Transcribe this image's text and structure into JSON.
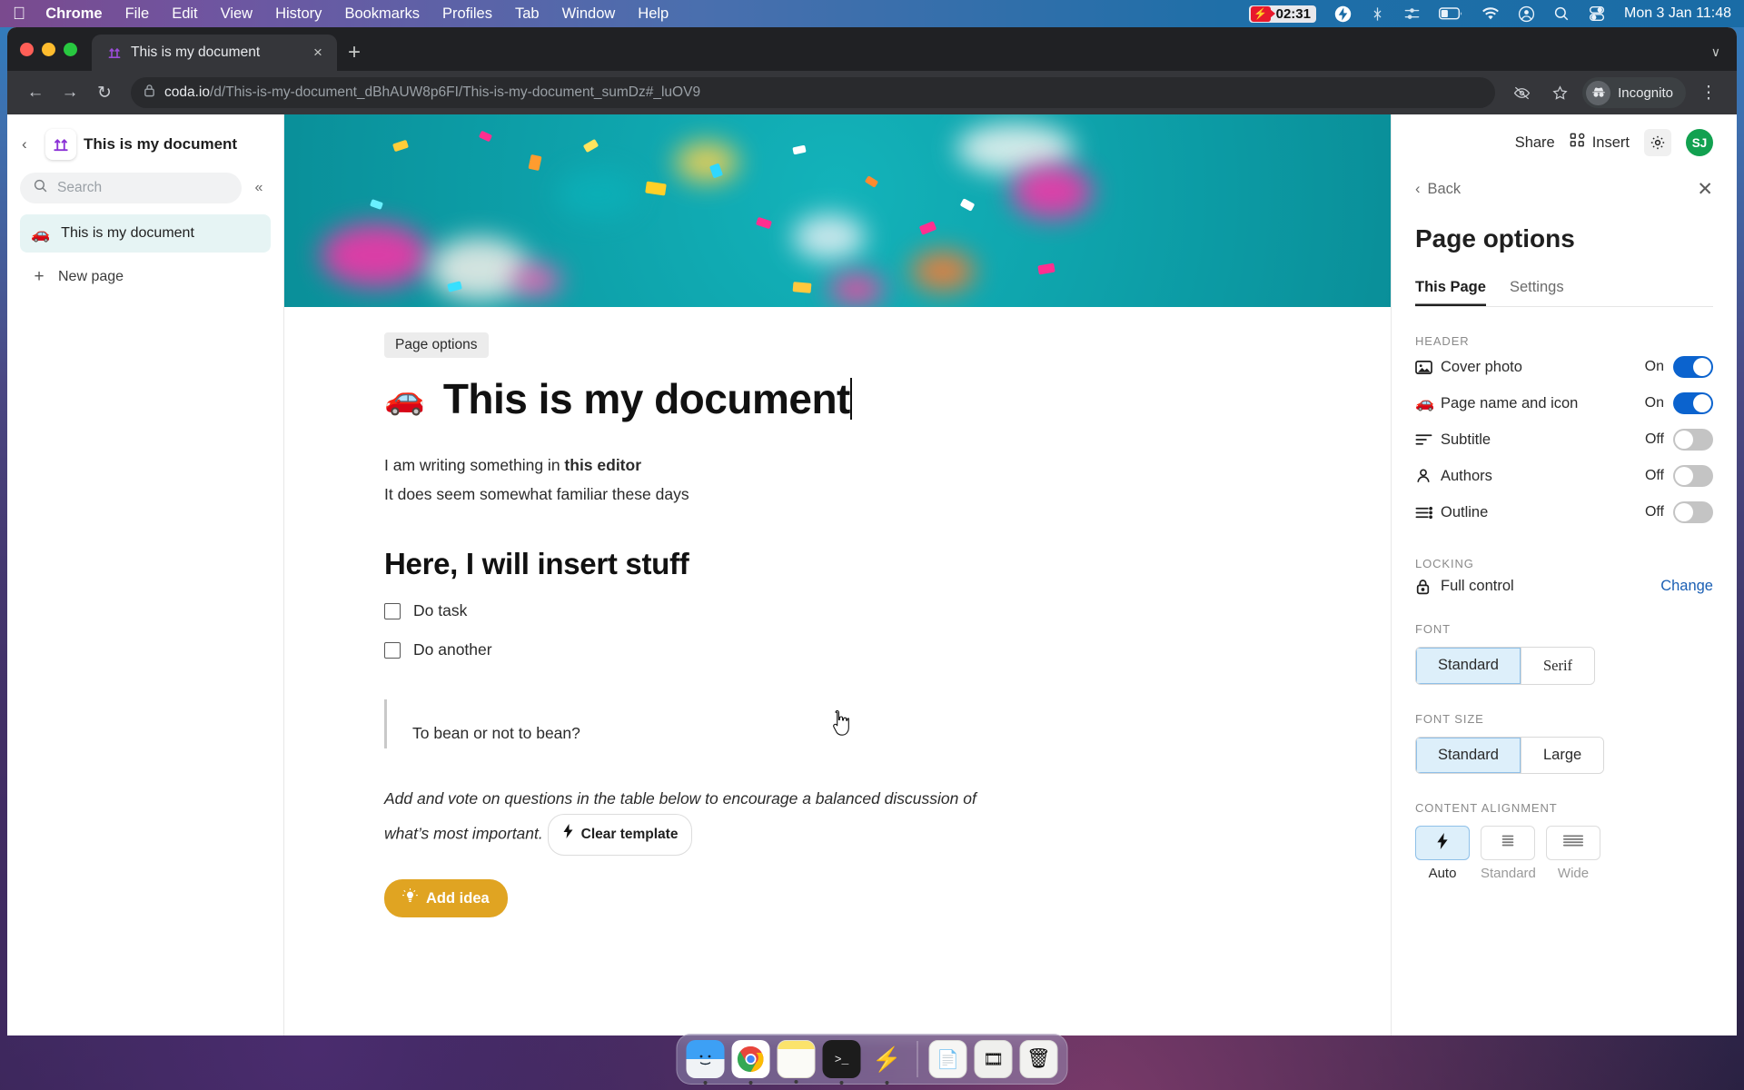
{
  "menubar": {
    "apple": "",
    "items": [
      {
        "label": "Chrome",
        "bold": true
      },
      {
        "label": "File",
        "bold": false
      },
      {
        "label": "Edit",
        "bold": false
      },
      {
        "label": "View",
        "bold": false
      },
      {
        "label": "History",
        "bold": false
      },
      {
        "label": "Bookmarks",
        "bold": false
      },
      {
        "label": "Profiles",
        "bold": false
      },
      {
        "label": "Tab",
        "bold": false
      },
      {
        "label": "Window",
        "bold": false
      },
      {
        "label": "Help",
        "bold": false
      }
    ],
    "recording_time": "02:31",
    "clock": "Mon 3 Jan  11:48",
    "status_icons": [
      "screen-recorder-icon",
      "lightning-icon",
      "bluetooth-off-icon",
      "control-center-icon",
      "battery-icon",
      "wifi-icon",
      "account-icon",
      "search-icon",
      "toggles-icon"
    ]
  },
  "browser": {
    "tab": {
      "title": "This is my document",
      "favicon": "coda-arrows-icon",
      "close": "×"
    },
    "new_tab": "+",
    "tab_list_chevron": "∨",
    "nav": {
      "back": "←",
      "forward": "→",
      "reload": "↻"
    },
    "url_domain": "coda.io",
    "url_path": "/d/This-is-my-document_dBhAUW8p6FI/This-is-my-document_sumDz#_luOV9",
    "lock_icon": "lock-icon",
    "eye_icon": "third-party-cookies-icon",
    "star_icon": "bookmark-star-icon",
    "incognito_label": "Incognito",
    "menu_icon": "⋮"
  },
  "sidebar": {
    "back_chevron": "‹",
    "doc_icon": "coda-arrows-icon",
    "doc_title": "This is my document",
    "search": {
      "placeholder": "Search",
      "value": "",
      "icon": "search-icon"
    },
    "collapse_icon": "«",
    "pages": [
      {
        "label": "This is my document",
        "emoji": "🚗",
        "active": true
      }
    ],
    "new_page": {
      "label": "New page",
      "icon": "plus-icon"
    }
  },
  "document": {
    "tooltip": "Page options",
    "emoji": "🚗",
    "title": "This is my document",
    "paragraphs": [
      {
        "text": "I am writing something in ",
        "bold_tail": "this editor"
      },
      {
        "text": "It does seem somewhat familiar these days",
        "bold_tail": ""
      }
    ],
    "heading2": "Here, I will insert stuff",
    "todos": [
      {
        "label": "Do task",
        "checked": false
      },
      {
        "label": "Do another",
        "checked": false
      }
    ],
    "quote": "To bean or not to bean?",
    "callout": "Add and vote on questions in the table below to encourage a balanced discussion of what’s most important.",
    "clear_template_button": "Clear template",
    "add_idea_button": "Add idea"
  },
  "right_panel": {
    "share_label": "Share",
    "insert_label": "Insert",
    "insert_icon": "grid-squares-icon",
    "gear_icon": "gear-icon",
    "avatar_initials": "SJ",
    "avatar_color": "#12a150",
    "back_label": "Back",
    "back_chevron": "‹",
    "close_icon": "✕",
    "title": "Page options",
    "tabs": [
      {
        "label": "This Page",
        "active": true
      },
      {
        "label": "Settings",
        "active": false
      }
    ],
    "header_section": {
      "label": "HEADER",
      "options": [
        {
          "label": "Cover photo",
          "state": "On",
          "on": true,
          "icon": "image-icon"
        },
        {
          "label": "Page name and icon",
          "state": "On",
          "on": true,
          "icon": "car-emoji-icon"
        },
        {
          "label": "Subtitle",
          "state": "Off",
          "on": false,
          "icon": "subtitle-lines-icon"
        },
        {
          "label": "Authors",
          "state": "Off",
          "on": false,
          "icon": "person-icon"
        },
        {
          "label": "Outline",
          "state": "Off",
          "on": false,
          "icon": "outline-icon"
        }
      ]
    },
    "locking_section": {
      "label": "LOCKING",
      "value": "Full control",
      "icon": "lock-icon",
      "change_link": "Change"
    },
    "font_section": {
      "label": "FONT",
      "options": [
        {
          "label": "Standard",
          "selected": true
        },
        {
          "label": "Serif",
          "selected": false
        }
      ]
    },
    "font_size_section": {
      "label": "FONT SIZE",
      "options": [
        {
          "label": "Standard",
          "selected": true
        },
        {
          "label": "Large",
          "selected": false
        }
      ]
    },
    "content_alignment_section": {
      "label": "CONTENT ALIGNMENT",
      "options": [
        {
          "caption": "Auto",
          "icon": "lightning-icon",
          "selected": true
        },
        {
          "caption": "Standard",
          "icon": "align-narrow-icon",
          "selected": false
        },
        {
          "caption": "Wide",
          "icon": "align-wide-icon",
          "selected": false
        }
      ]
    },
    "accent_color": "#0b63ce",
    "selected_bg": "#ddeffa"
  },
  "dock": {
    "items": [
      {
        "name": "finder",
        "glyph": "🖼",
        "running": true
      },
      {
        "name": "chrome",
        "glyph": "●",
        "running": true
      },
      {
        "name": "notes",
        "glyph": "🗒",
        "running": true
      },
      {
        "name": "terminal",
        "glyph": "▸",
        "running": true
      },
      {
        "name": "bolt-app",
        "glyph": "⚡",
        "running": true
      },
      {
        "name": "document-file",
        "glyph": "📄",
        "running": false
      },
      {
        "name": "media-file",
        "glyph": "🎞",
        "running": false
      },
      {
        "name": "trash",
        "glyph": "🗑",
        "running": false
      }
    ]
  }
}
